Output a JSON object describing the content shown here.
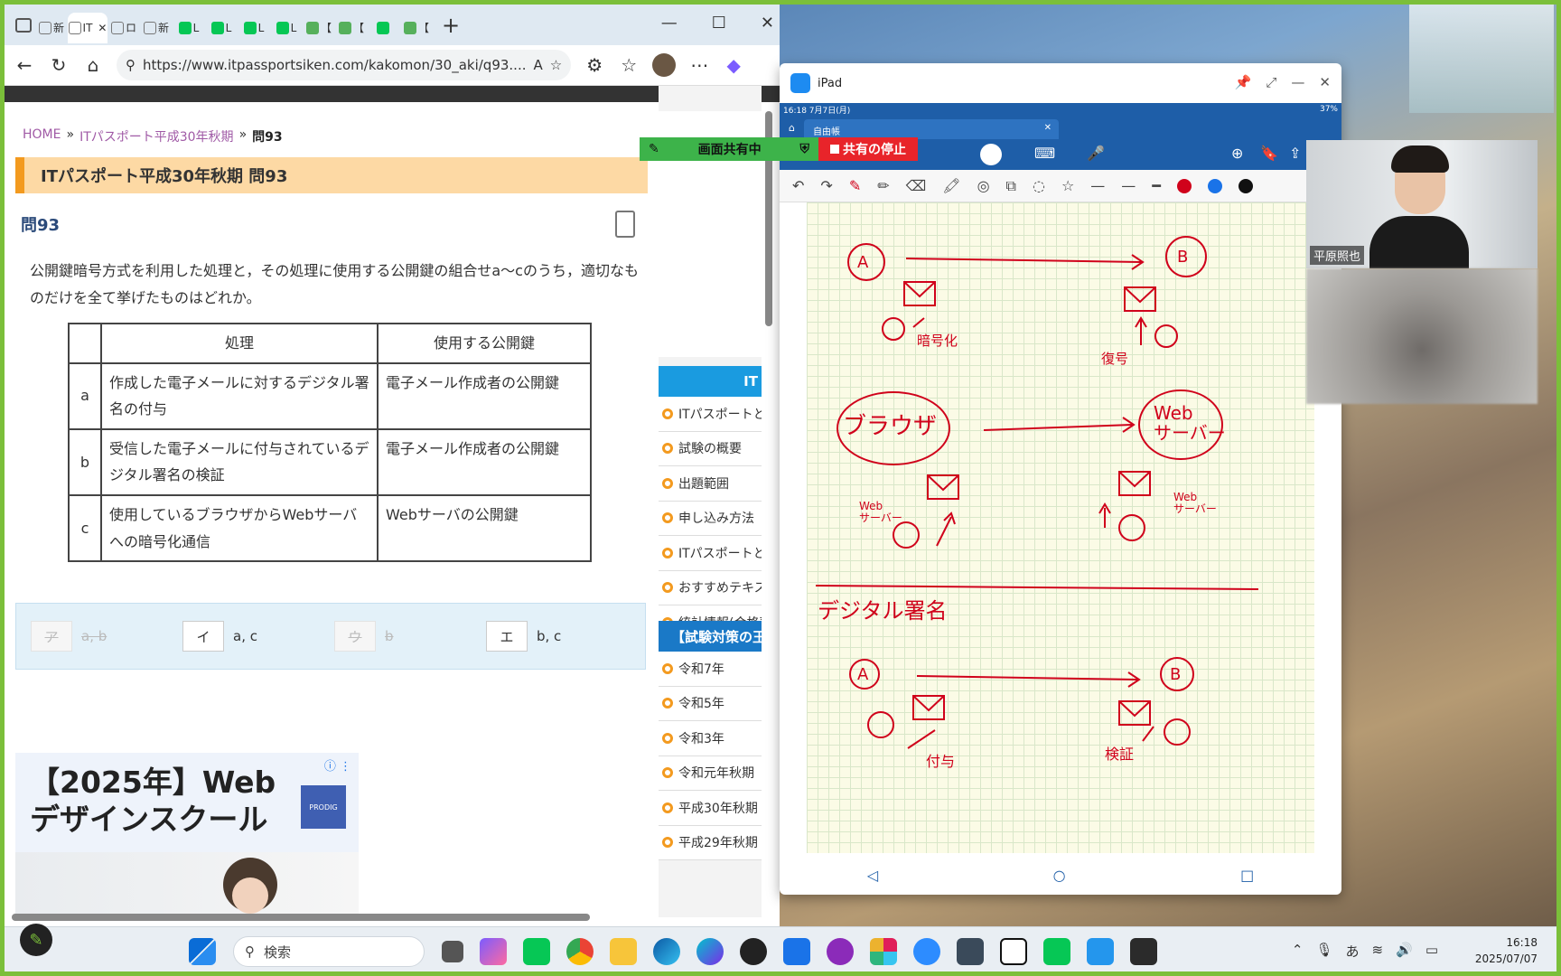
{
  "browser": {
    "tabs": [
      {
        "label": "新",
        "icon": "page-icon"
      },
      {
        "label": "IT",
        "icon": "page-icon",
        "active": true,
        "close": "✕"
      },
      {
        "label": "ロ",
        "icon": "page-icon"
      },
      {
        "label": "新",
        "icon": "page-icon"
      },
      {
        "label": "L",
        "icon": "line-icon"
      },
      {
        "label": "L",
        "icon": "line-icon"
      },
      {
        "label": "L",
        "icon": "line-icon"
      },
      {
        "label": "L",
        "icon": "line-icon"
      },
      {
        "label": "【",
        "icon": "plus-icon"
      },
      {
        "label": "【",
        "icon": "plus-icon"
      },
      {
        "label": "",
        "icon": "line-icon"
      },
      {
        "label": "【",
        "icon": "plus-icon"
      }
    ],
    "new_tab": "+",
    "url": "https://www.itpassportsiken.com/kakomon/30_aki/q93...."
  },
  "page": {
    "breadcrumb": {
      "home": "HOME",
      "sep": "»",
      "section": "ITパスポート平成30年秋期",
      "current": "問93"
    },
    "title": "ITパスポート平成30年秋期 問93",
    "question_no": "問93",
    "question_text": "公開鍵暗号方式を利用した処理と，その処理に使用する公開鍵の組合せa〜cのうち，適切なものだけを全て挙げたものはどれか。",
    "table": {
      "headers": [
        "",
        "処理",
        "使用する公開鍵"
      ],
      "rows": [
        {
          "key": "a",
          "process": "作成した電子メールに対するデジタル署名の付与",
          "key_used": "電子メール作成者の公開鍵"
        },
        {
          "key": "b",
          "process": "受信した電子メールに付与されているデジタル署名の検証",
          "key_used": "電子メール作成者の公開鍵"
        },
        {
          "key": "c",
          "process": "使用しているブラウザからWebサーバへの暗号化通信",
          "key_used": "Webサーバの公開鍵"
        }
      ]
    },
    "answers": [
      {
        "key": "ア",
        "text": "a, b",
        "disabled": true
      },
      {
        "key": "イ",
        "text": "a, c",
        "disabled": false
      },
      {
        "key": "ウ",
        "text": "b",
        "disabled": true
      },
      {
        "key": "エ",
        "text": "b, c",
        "disabled": false
      }
    ],
    "ad": {
      "title_line1": "【2025年】Web",
      "title_line2": "デザインスクール",
      "logo": "PRODIG"
    },
    "sidebar": {
      "header1": "IT",
      "menu": [
        "ITパスポートと",
        "試験の概要",
        "出題範囲",
        "申し込み方法",
        "ITパスポートと",
        "おすすめテキス",
        "統計情報(合格率"
      ],
      "header2": "【試験対策の王",
      "years": [
        "令和7年",
        "令和5年",
        "令和3年",
        "令和元年秋期",
        "平成30年秋期",
        "平成29年秋期"
      ]
    }
  },
  "share": {
    "active_label": "画面共有中",
    "stop_label": "共有の停止"
  },
  "ipad": {
    "window_title": "iPad",
    "status_time": "16:18  7月7日(月)",
    "status_battery": "37%",
    "tab_label": "自由帳",
    "tab_close": "✕",
    "colors": {
      "red": "#d0021b",
      "blue": "#1a73e8",
      "black": "#111111"
    },
    "notes": {
      "nodeA": "A",
      "nodeB": "B",
      "encrypt": "暗号化",
      "decrypt": "復号",
      "browser": "ブラウザ",
      "webserver": "Web\nサーバー",
      "web_small": "Web\nサーバー",
      "digital_signature": "デジタル署名",
      "sign": "付与",
      "verify": "検証"
    }
  },
  "video": {
    "participant1": "平原照也"
  },
  "taskbar": {
    "search_placeholder": "検索",
    "time": "16:18",
    "date": "2025/07/07",
    "ime": "あ"
  }
}
